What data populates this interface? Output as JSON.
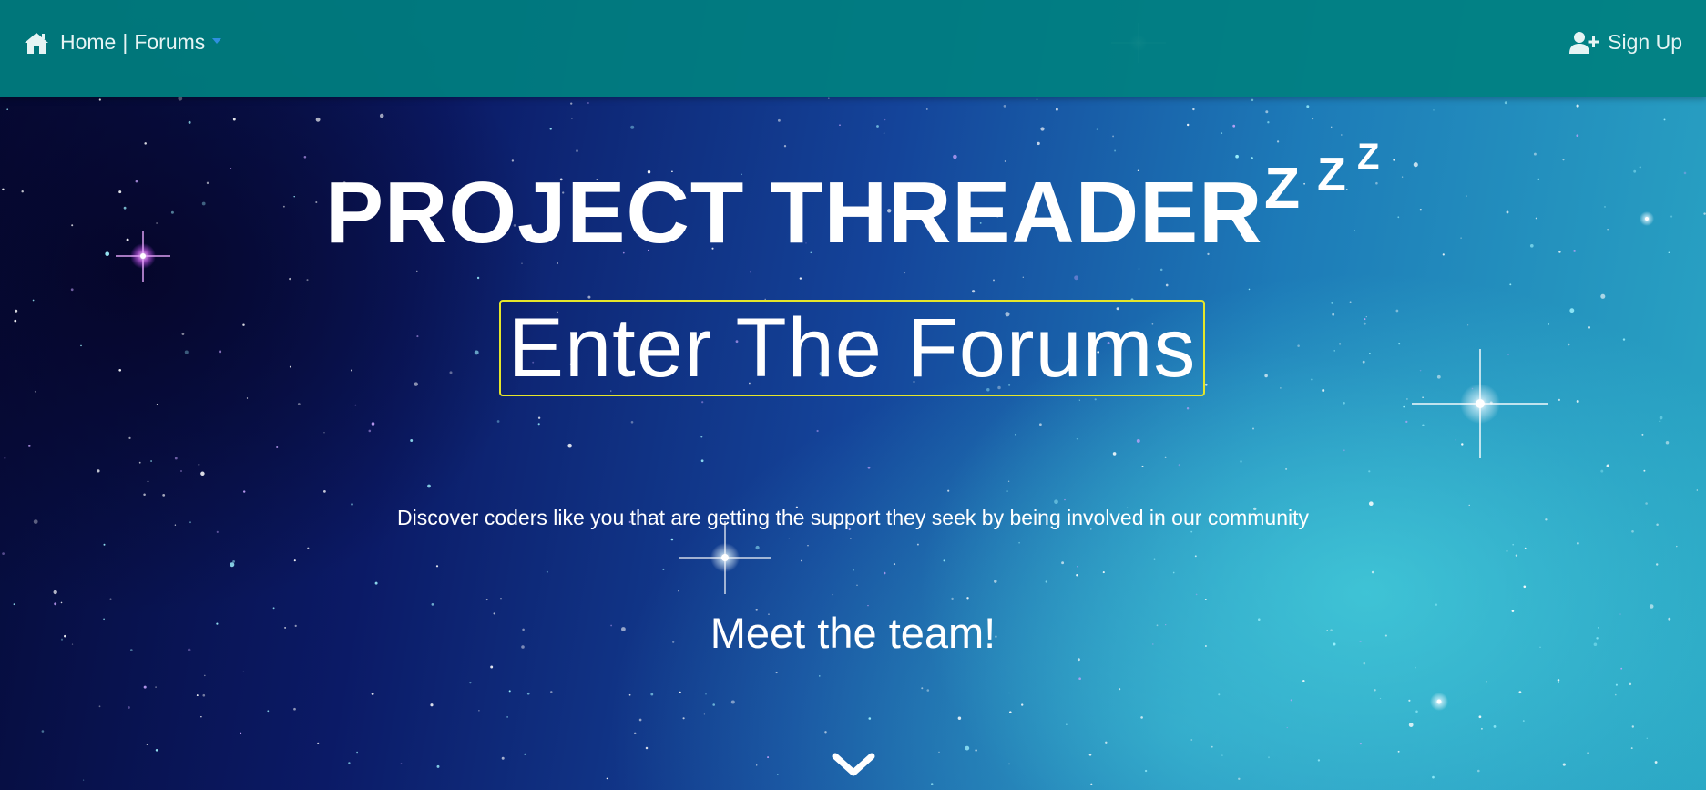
{
  "nav": {
    "home_icon": "home-icon",
    "home_label": "Home",
    "separator": "|",
    "forums_label": "Forums",
    "dropdown_icon": "caret-down-icon",
    "signup_icon": "user-plus-icon",
    "signup_label": "Sign Up"
  },
  "hero": {
    "title": "PROJECT THREADER",
    "zzz": [
      "Z",
      "Z",
      "Z"
    ],
    "enter_button": "Enter The Forums",
    "tagline": "Discover coders like you that are getting the support they seek by being involved in our community",
    "team_heading": "Meet the team!",
    "scroll_icon": "chevron-down-icon"
  },
  "colors": {
    "navbar": "#008080",
    "button_border": "#e6e62a",
    "dropdown_caret": "#2f8fe0",
    "text": "#ffffff"
  }
}
